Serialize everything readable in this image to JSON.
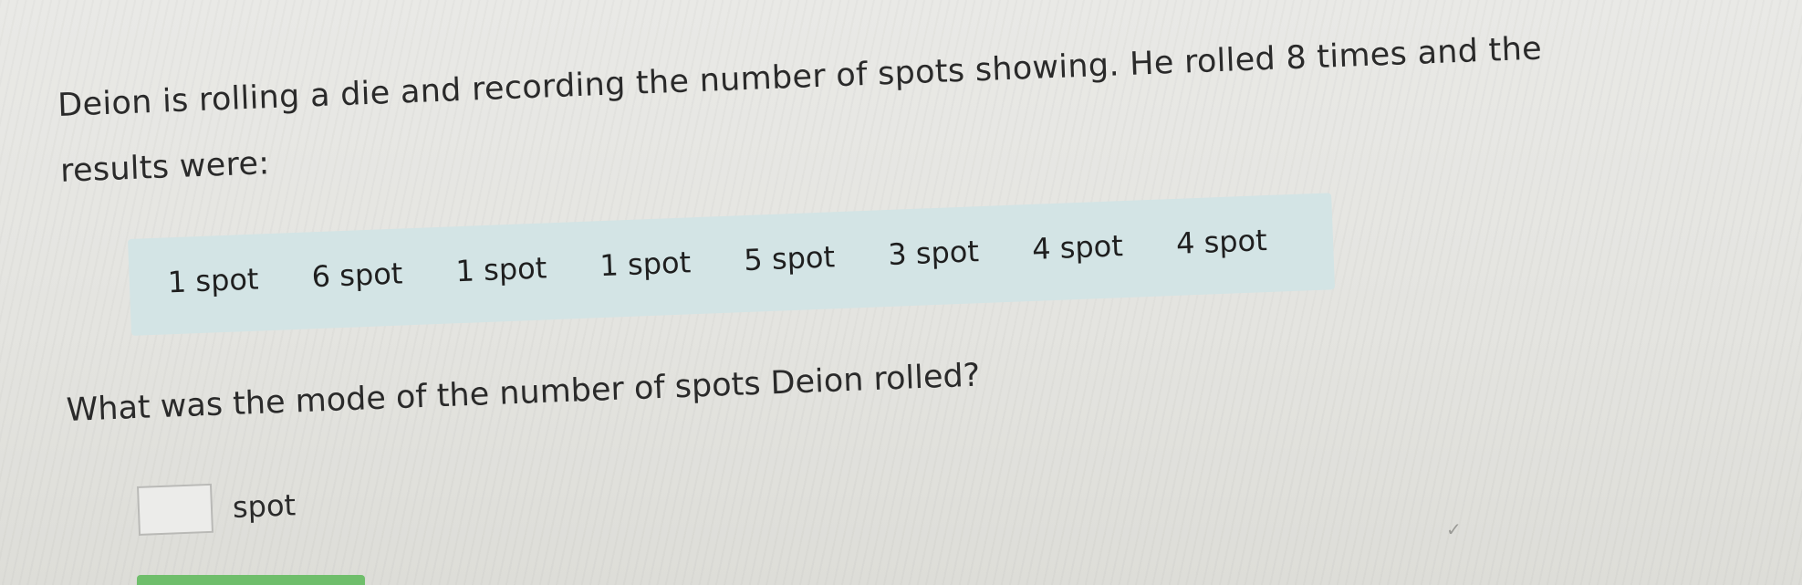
{
  "question": {
    "line1": "Deion is rolling a die and recording the number of spots showing. He rolled 8 times and the",
    "line2": "results were:"
  },
  "results": [
    {
      "label": "1 spot"
    },
    {
      "label": "6 spot"
    },
    {
      "label": "1 spot"
    },
    {
      "label": "1 spot"
    },
    {
      "label": "5 spot"
    },
    {
      "label": "3 spot"
    },
    {
      "label": "4 spot"
    },
    {
      "label": "4 spot"
    }
  ],
  "prompt": "What was the mode of the number of spots Deion rolled?",
  "answer": {
    "value": "",
    "unit": "spot"
  },
  "icons": {
    "check": "check-icon"
  },
  "colors": {
    "results_background": "#d3e4e5",
    "progress_green": "#6fbe6b"
  }
}
